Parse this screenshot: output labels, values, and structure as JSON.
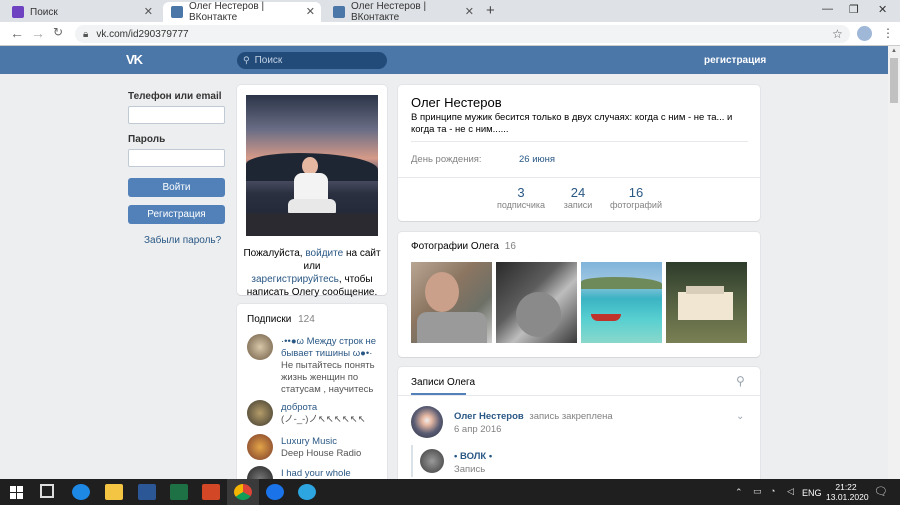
{
  "browser": {
    "tabs": [
      {
        "title": "Поиск",
        "icon_color": "#6f42c1"
      },
      {
        "title": "Олег Нестеров | ВКонтакте",
        "icon_color": "#4a76a8"
      },
      {
        "title": "Олег Нестеров | ВКонтакте",
        "icon_color": "#4a76a8"
      }
    ],
    "new_tab": "+",
    "url": "vk.com/id290379777",
    "back": "←",
    "forward": "→",
    "reload": "C"
  },
  "vk_header": {
    "logo": "VK",
    "search_placeholder": "Поиск",
    "register_link": "регистрация"
  },
  "login": {
    "phone_label": "Телефон или email",
    "password_label": "Пароль",
    "login_button": "Войти",
    "register_button": "Регистрация",
    "forgot": "Забыли пароль?"
  },
  "avatar_card": {
    "text_1": "Пожалуйста, ",
    "link_1": "войдите",
    "text_2": " на сайт или",
    "link_2": "зарегистрируйтесь",
    "text_3": ", чтобы",
    "text_4": "написать Олегу сообщение."
  },
  "subscriptions": {
    "title": "Подписки",
    "count": "124",
    "items": [
      {
        "name": "·••●ω Между строк не бывает тишины ω●•·",
        "sub": "Не пытайтесь понять жизнь женщин по статусам , научитесь"
      },
      {
        "name": "доброта",
        "sub": "(ノ-_-)ノ↖↖↖↖↖↖"
      },
      {
        "name": "Luxury Music",
        "sub": "Deep House Radio"
      },
      {
        "name": "I had your whole pathos,",
        "sub": ""
      }
    ]
  },
  "profile": {
    "name": "Олег Нестеров",
    "status": "В принципе мужик бесится только в двух случаях: когда с ним - не та... и когда та - не с ним......",
    "birthday_label": "День рождения:",
    "birthday_value": "26 июня",
    "counters": [
      {
        "value": "3",
        "label": "подписчика"
      },
      {
        "value": "24",
        "label": "записи"
      },
      {
        "value": "16",
        "label": "фотографий"
      }
    ]
  },
  "photos": {
    "title": "Фотографии Олега",
    "count": "16"
  },
  "wall": {
    "title": "Записи Олега",
    "post_author": "Олег Нестеров",
    "post_pinned": "запись закреплена",
    "post_date": "6 апр 2016",
    "repost_author": "• ВОЛК •",
    "repost_type": "Запись"
  },
  "taskbar": {
    "lang": "ENG",
    "time": "21:22",
    "date": "13.01.2020"
  },
  "colors": {
    "vk_blue": "#4a76a8",
    "button_blue": "#5181b8",
    "link": "#2a5885",
    "bg": "#edeef0"
  }
}
